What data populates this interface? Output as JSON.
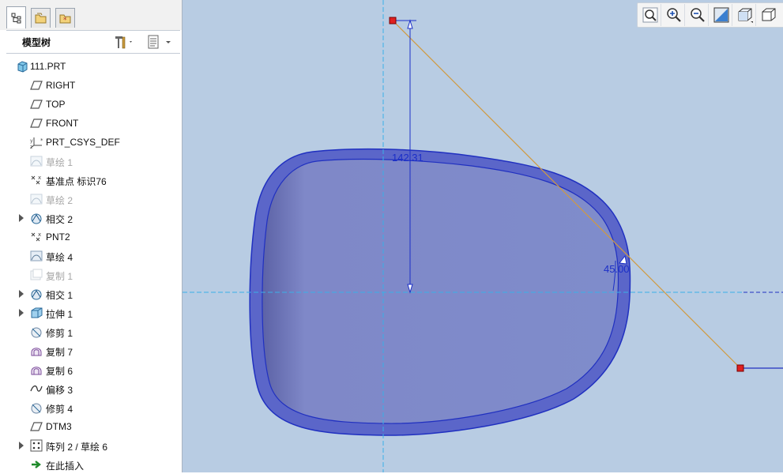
{
  "model_tree": {
    "title": "模型树",
    "tabs": [
      "model-tree-tab",
      "layers-tab",
      "favorites-tab"
    ],
    "items": [
      {
        "label": "111.PRT",
        "icon": "part-icon",
        "expandable": false,
        "dim": false,
        "root": true
      },
      {
        "label": "RIGHT",
        "icon": "datum-plane-icon",
        "expandable": false,
        "dim": false
      },
      {
        "label": "TOP",
        "icon": "datum-plane-icon",
        "expandable": false,
        "dim": false
      },
      {
        "label": "FRONT",
        "icon": "datum-plane-icon",
        "expandable": false,
        "dim": false
      },
      {
        "label": "PRT_CSYS_DEF",
        "icon": "csys-icon",
        "expandable": false,
        "dim": false
      },
      {
        "label": "草绘 1",
        "icon": "sketch-icon",
        "expandable": false,
        "dim": true
      },
      {
        "label": "基准点 标识76",
        "icon": "datum-point-icon",
        "expandable": false,
        "dim": false
      },
      {
        "label": "草绘 2",
        "icon": "sketch-icon",
        "expandable": false,
        "dim": true
      },
      {
        "label": "相交 2",
        "icon": "intersect-icon",
        "expandable": true,
        "dim": false
      },
      {
        "label": "PNT2",
        "icon": "datum-point-icon",
        "expandable": false,
        "dim": false
      },
      {
        "label": "草绘 4",
        "icon": "sketch-icon",
        "expandable": false,
        "dim": false
      },
      {
        "label": "复制 1",
        "icon": "copy-icon",
        "expandable": false,
        "dim": true
      },
      {
        "label": "相交 1",
        "icon": "intersect-icon",
        "expandable": true,
        "dim": false
      },
      {
        "label": "拉伸 1",
        "icon": "extrude-icon",
        "expandable": true,
        "dim": false
      },
      {
        "label": "修剪 1",
        "icon": "trim-icon",
        "expandable": false,
        "dim": false
      },
      {
        "label": "复制 7",
        "icon": "copy-surface-icon",
        "expandable": false,
        "dim": false
      },
      {
        "label": "复制 6",
        "icon": "copy-surface-icon",
        "expandable": false,
        "dim": false
      },
      {
        "label": "偏移 3",
        "icon": "offset-icon",
        "expandable": false,
        "dim": false
      },
      {
        "label": "修剪 4",
        "icon": "trim-icon",
        "expandable": false,
        "dim": false
      },
      {
        "label": "DTM3",
        "icon": "datum-plane-icon",
        "expandable": false,
        "dim": false
      },
      {
        "label": "阵列 2 / 草绘 6",
        "icon": "pattern-icon",
        "expandable": true,
        "dim": false
      },
      {
        "label": "在此插入",
        "icon": "insert-here-icon",
        "expandable": false,
        "dim": false
      }
    ]
  },
  "graphics": {
    "background_color": "#b8cce3",
    "dimension_length": "142.31",
    "dimension_angle": "45.00",
    "toolbar": [
      "refit-icon",
      "zoom-in-icon",
      "zoom-out-icon",
      "repaint-icon",
      "saved-views-icon",
      "display-style-icon"
    ]
  }
}
